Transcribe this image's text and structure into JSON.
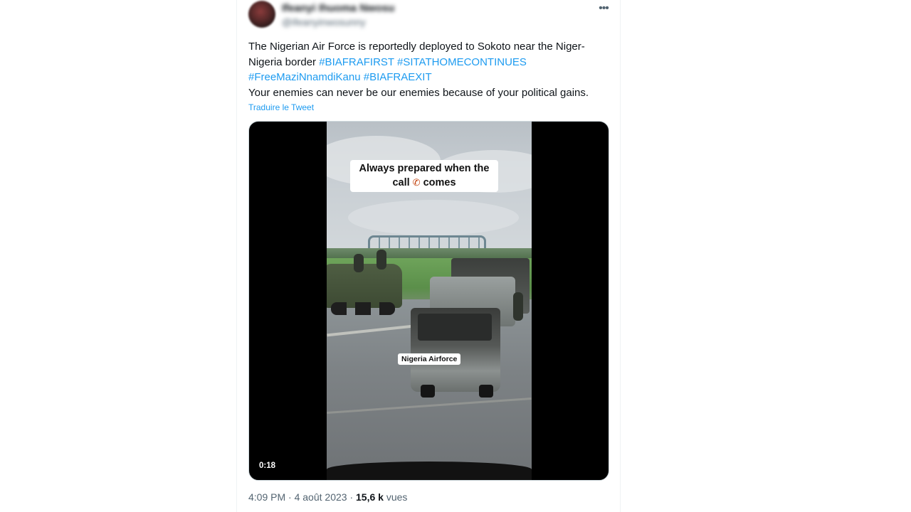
{
  "author": {
    "display_name": "Ifeanyi Ihuoma Nwosu",
    "handle": "@ifeanyinwosunny"
  },
  "tweet": {
    "text_before": "The Nigerian Air Force is reportedly deployed to Sokoto near the Niger-Nigeria border ",
    "hashtags": [
      "#BIAFRAFIRST",
      "#SITATHOMECONTINUES",
      "#FreeMaziNnamdiKanu",
      "#BIAFRAEXIT"
    ],
    "text_after": "Your enemies can never be our enemies because of your political gains.",
    "translate_label": "Traduire le Tweet",
    "more_icon": "more-horizontal-icon"
  },
  "video": {
    "caption_line1": "Always prepared when the",
    "caption_line2_a": "call",
    "caption_line2_b": "comes",
    "phone_icon": "phone-icon",
    "overlay_label": "Nigeria Airforce",
    "duration": "0:18"
  },
  "meta": {
    "time": "4:09 PM",
    "separator": "·",
    "date": "4 août 2023",
    "views_count": "15,6 k",
    "views_label": "vues"
  }
}
